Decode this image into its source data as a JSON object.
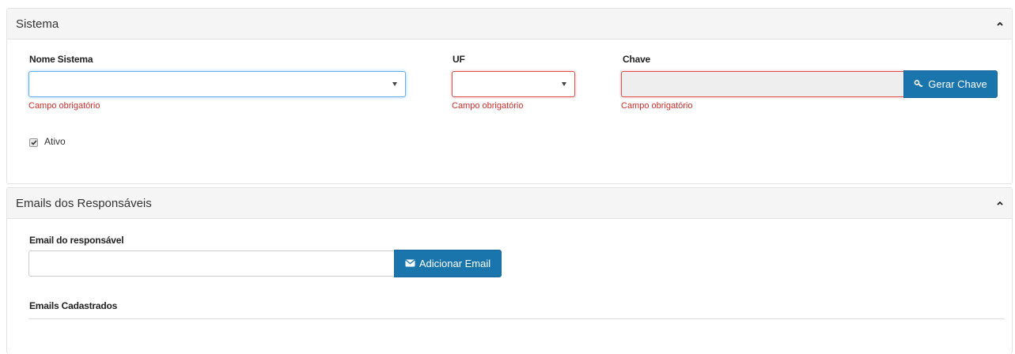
{
  "sistema_panel": {
    "title": "Sistema",
    "nome_sistema": {
      "label": "Nome Sistema",
      "value": "",
      "error": "Campo obrigatório"
    },
    "uf": {
      "label": "UF",
      "value": "",
      "error": "Campo obrigatório"
    },
    "chave": {
      "label": "Chave",
      "value": "",
      "error": "Campo obrigatório",
      "button_label": "Gerar Chave"
    },
    "ativo": {
      "label": "Ativo",
      "checked": true
    }
  },
  "emails_panel": {
    "title": "Emails dos Responsáveis",
    "email_field": {
      "label": "Email do responsável",
      "value": "",
      "button_label": "Adicionar Email"
    },
    "cadastrados_label": "Emails Cadastrados"
  },
  "colors": {
    "primary_button": "#1b75ad",
    "error": "#c9302c",
    "focus": "#66afe9"
  }
}
